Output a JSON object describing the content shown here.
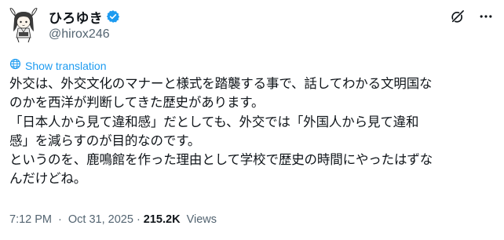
{
  "author": {
    "display_name": "ひろゆき",
    "handle": "@hirox246"
  },
  "icons": {
    "avatar": "avatar-illustration",
    "verified": "verified-badge-icon",
    "grok": "grok-icon",
    "more": "more-options-icon",
    "translate": "globe-icon"
  },
  "colors": {
    "accent": "#1d9bf0",
    "text": "#0f1419",
    "secondary": "#536471"
  },
  "translation": {
    "label": "Show translation"
  },
  "tweet": {
    "lines": [
      "外交は、外交文化のマナーと様式を踏襲する事で、話してわかる文明国な",
      "のかを西洋が判断してきた歴史があります。",
      "「日本人から見て違和感」だとしても、外交では「外国人から見て違和",
      "感」を減らすのが目的なのです。",
      "というのを、鹿鳴館を作った理由として学校で歴史の時間にやったはずな",
      "んだけどね。"
    ]
  },
  "meta": {
    "time": "7:12 PM",
    "separator": "·",
    "date": "Oct 31, 2025",
    "views_count": "215.2K",
    "views_label": "Views"
  }
}
